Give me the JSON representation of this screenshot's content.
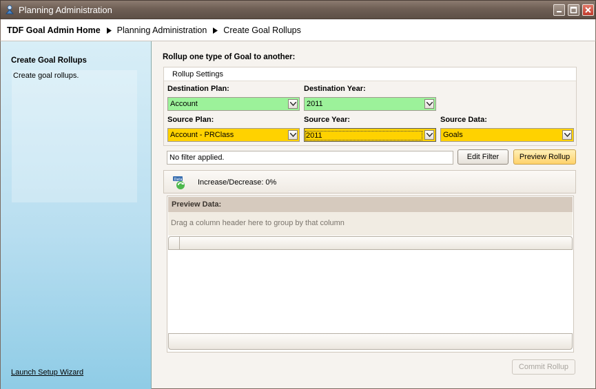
{
  "window": {
    "title": "Planning Administration",
    "buttons": [
      "minimize",
      "maximize",
      "close"
    ]
  },
  "breadcrumb": {
    "items": [
      "TDF Goal Admin Home",
      "Planning Administration",
      "Create Goal Rollups"
    ]
  },
  "sidebar": {
    "heading": "Create Goal Rollups",
    "description": "Create goal rollups.",
    "link": "Launch Setup Wizard"
  },
  "main": {
    "heading": "Rollup one type of Goal to another:",
    "settings_title": "Rollup Settings",
    "fields": {
      "destination_plan": {
        "label": "Destination Plan:",
        "value": "Account",
        "color": "#9cf29a"
      },
      "destination_year": {
        "label": "Destination Year:",
        "value": "2011",
        "color": "#9cf29a"
      },
      "source_plan": {
        "label": "Source Plan:",
        "value": "Account - PRClass",
        "color": "#ffd200"
      },
      "source_year": {
        "label": "Source Year:",
        "value": "2011",
        "color": "#ffd200"
      },
      "source_data": {
        "label": "Source Data:",
        "value": "Goals",
        "color": "#ffd200"
      }
    },
    "filter_text": "No filter applied.",
    "edit_filter_label": "Edit Filter",
    "preview_rollup_label": "Preview Rollup",
    "increase_label": "Increase/Decrease: 0%",
    "data_icon": "data-refresh-icon",
    "preview": {
      "title": "Preview Data:",
      "group_hint": "Drag a column header here to group by that column"
    },
    "commit_label": "Commit Rollup"
  }
}
